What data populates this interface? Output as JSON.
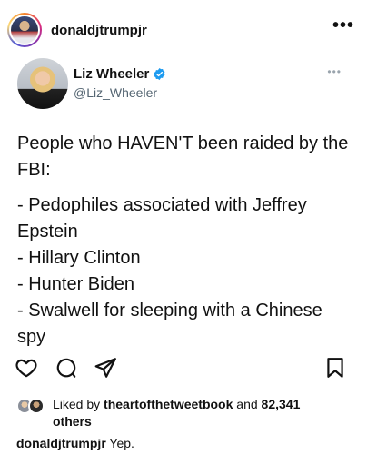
{
  "post": {
    "username": "donaldjtrumpjr",
    "more_label": "•••"
  },
  "tweet": {
    "author_name": "Liz Wheeler",
    "author_handle": "@Liz_Wheeler",
    "more_label": "•••",
    "intro": "People who HAVEN'T been raided by the FBI:",
    "items": [
      "- Pedophiles associated with Jeffrey Epstein",
      "- Hillary Clinton",
      "- Hunter Biden",
      "- Swalwell for sleeping with a Chinese spy"
    ]
  },
  "actions": {
    "like_icon": "heart-icon",
    "comment_icon": "comment-icon",
    "share_icon": "send-icon",
    "save_icon": "bookmark-icon"
  },
  "likes": {
    "prefix": "Liked by ",
    "liker": "theartofthetweetbook",
    "middle": " and ",
    "count": "82,341",
    "suffix": "others"
  },
  "caption": {
    "username": "donaldjtrumpjr",
    "text": "Yep."
  },
  "colors": {
    "verified": "#1d9bf0",
    "handle": "#536471"
  }
}
